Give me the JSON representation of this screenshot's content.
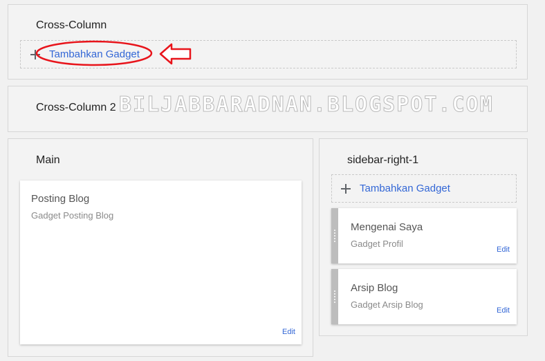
{
  "cross_column": {
    "title": "Cross-Column",
    "add_label": "Tambahkan Gadget"
  },
  "cross_column_2": {
    "title": "Cross-Column 2"
  },
  "watermark": "BILJABBARADNAN.BLOGSPOT.COM",
  "main": {
    "title": "Main",
    "card": {
      "title": "Posting Blog",
      "subtitle": "Gadget Posting Blog",
      "edit": "Edit"
    }
  },
  "sidebar": {
    "title": "sidebar-right-1",
    "add_label": "Tambahkan Gadget",
    "cards": [
      {
        "title": "Mengenai Saya",
        "subtitle": "Gadget Profil",
        "edit": "Edit"
      },
      {
        "title": "Arsip Blog",
        "subtitle": "Gadget Arsip Blog",
        "edit": "Edit"
      }
    ]
  },
  "colors": {
    "link": "#3367d6",
    "annotation": "#e8141b",
    "panel": "#f3f3f3",
    "border": "#d6d6d6"
  },
  "icons": [
    "plus-icon",
    "drag-handle-icon"
  ]
}
